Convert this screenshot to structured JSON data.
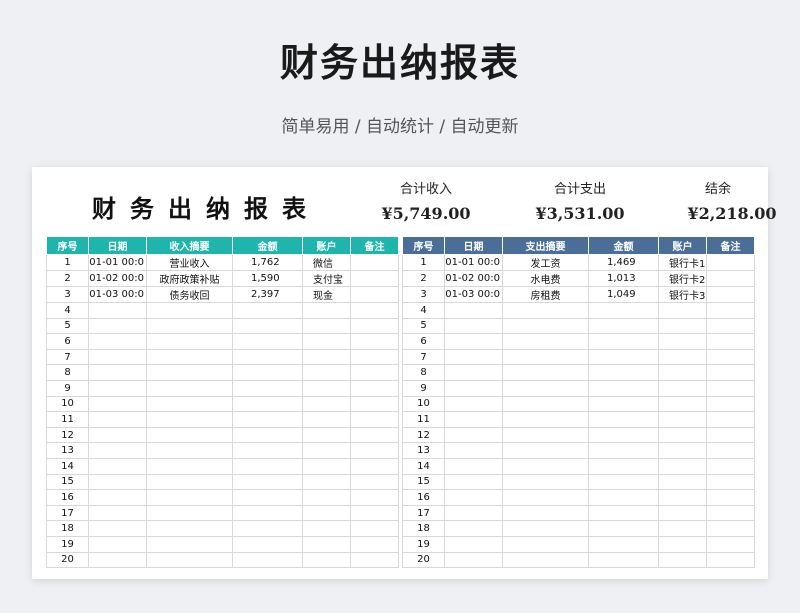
{
  "header": {
    "title": "财务出纳报表",
    "subtitle": "简单易用 / 自动统计 / 自动更新"
  },
  "sheet": {
    "title": "财务出纳报表",
    "summary": [
      {
        "label": "合计收入",
        "value": "¥5,749.00"
      },
      {
        "label": "合计支出",
        "value": "¥3,531.00"
      },
      {
        "label": "结余",
        "value": "¥2,218.00"
      }
    ],
    "income": {
      "headers": [
        "序号",
        "日期",
        "收入摘要",
        "金额",
        "账户",
        "备注"
      ],
      "rows": [
        [
          "1",
          "X-01-01 00:0",
          "营业收入",
          "1,762",
          "微信",
          ""
        ],
        [
          "2",
          "X-01-02 00:0",
          "政府政策补贴",
          "1,590",
          "支付宝",
          ""
        ],
        [
          "3",
          "X-01-03 00:0",
          "债务收回",
          "2,397",
          "现金",
          ""
        ],
        [
          "4",
          "",
          "",
          "",
          "",
          ""
        ],
        [
          "5",
          "",
          "",
          "",
          "",
          ""
        ],
        [
          "6",
          "",
          "",
          "",
          "",
          ""
        ],
        [
          "7",
          "",
          "",
          "",
          "",
          ""
        ],
        [
          "8",
          "",
          "",
          "",
          "",
          ""
        ],
        [
          "9",
          "",
          "",
          "",
          "",
          ""
        ],
        [
          "10",
          "",
          "",
          "",
          "",
          ""
        ],
        [
          "11",
          "",
          "",
          "",
          "",
          ""
        ],
        [
          "12",
          "",
          "",
          "",
          "",
          ""
        ],
        [
          "13",
          "",
          "",
          "",
          "",
          ""
        ],
        [
          "14",
          "",
          "",
          "",
          "",
          ""
        ],
        [
          "15",
          "",
          "",
          "",
          "",
          ""
        ],
        [
          "16",
          "",
          "",
          "",
          "",
          ""
        ],
        [
          "17",
          "",
          "",
          "",
          "",
          ""
        ],
        [
          "18",
          "",
          "",
          "",
          "",
          ""
        ],
        [
          "19",
          "",
          "",
          "",
          "",
          ""
        ],
        [
          "20",
          "",
          "",
          "",
          "",
          ""
        ]
      ]
    },
    "expense": {
      "headers": [
        "序号",
        "日期",
        "支出摘要",
        "金额",
        "账户",
        "备注"
      ],
      "rows": [
        [
          "1",
          "X-01-01 00:0",
          "发工资",
          "1,469",
          "银行卡1",
          ""
        ],
        [
          "2",
          "X-01-02 00:0",
          "水电费",
          "1,013",
          "银行卡2",
          ""
        ],
        [
          "3",
          "X-01-03 00:0",
          "房租费",
          "1,049",
          "银行卡3",
          ""
        ],
        [
          "4",
          "",
          "",
          "",
          "",
          ""
        ],
        [
          "5",
          "",
          "",
          "",
          "",
          ""
        ],
        [
          "6",
          "",
          "",
          "",
          "",
          ""
        ],
        [
          "7",
          "",
          "",
          "",
          "",
          ""
        ],
        [
          "8",
          "",
          "",
          "",
          "",
          ""
        ],
        [
          "9",
          "",
          "",
          "",
          "",
          ""
        ],
        [
          "10",
          "",
          "",
          "",
          "",
          ""
        ],
        [
          "11",
          "",
          "",
          "",
          "",
          ""
        ],
        [
          "12",
          "",
          "",
          "",
          "",
          ""
        ],
        [
          "13",
          "",
          "",
          "",
          "",
          ""
        ],
        [
          "14",
          "",
          "",
          "",
          "",
          ""
        ],
        [
          "15",
          "",
          "",
          "",
          "",
          ""
        ],
        [
          "16",
          "",
          "",
          "",
          "",
          ""
        ],
        [
          "17",
          "",
          "",
          "",
          "",
          ""
        ],
        [
          "18",
          "",
          "",
          "",
          "",
          ""
        ],
        [
          "19",
          "",
          "",
          "",
          "",
          ""
        ],
        [
          "20",
          "",
          "",
          "",
          "",
          ""
        ]
      ]
    },
    "colors": {
      "income_header": "#1fb5ad",
      "expense_header": "#4a6e98"
    }
  }
}
